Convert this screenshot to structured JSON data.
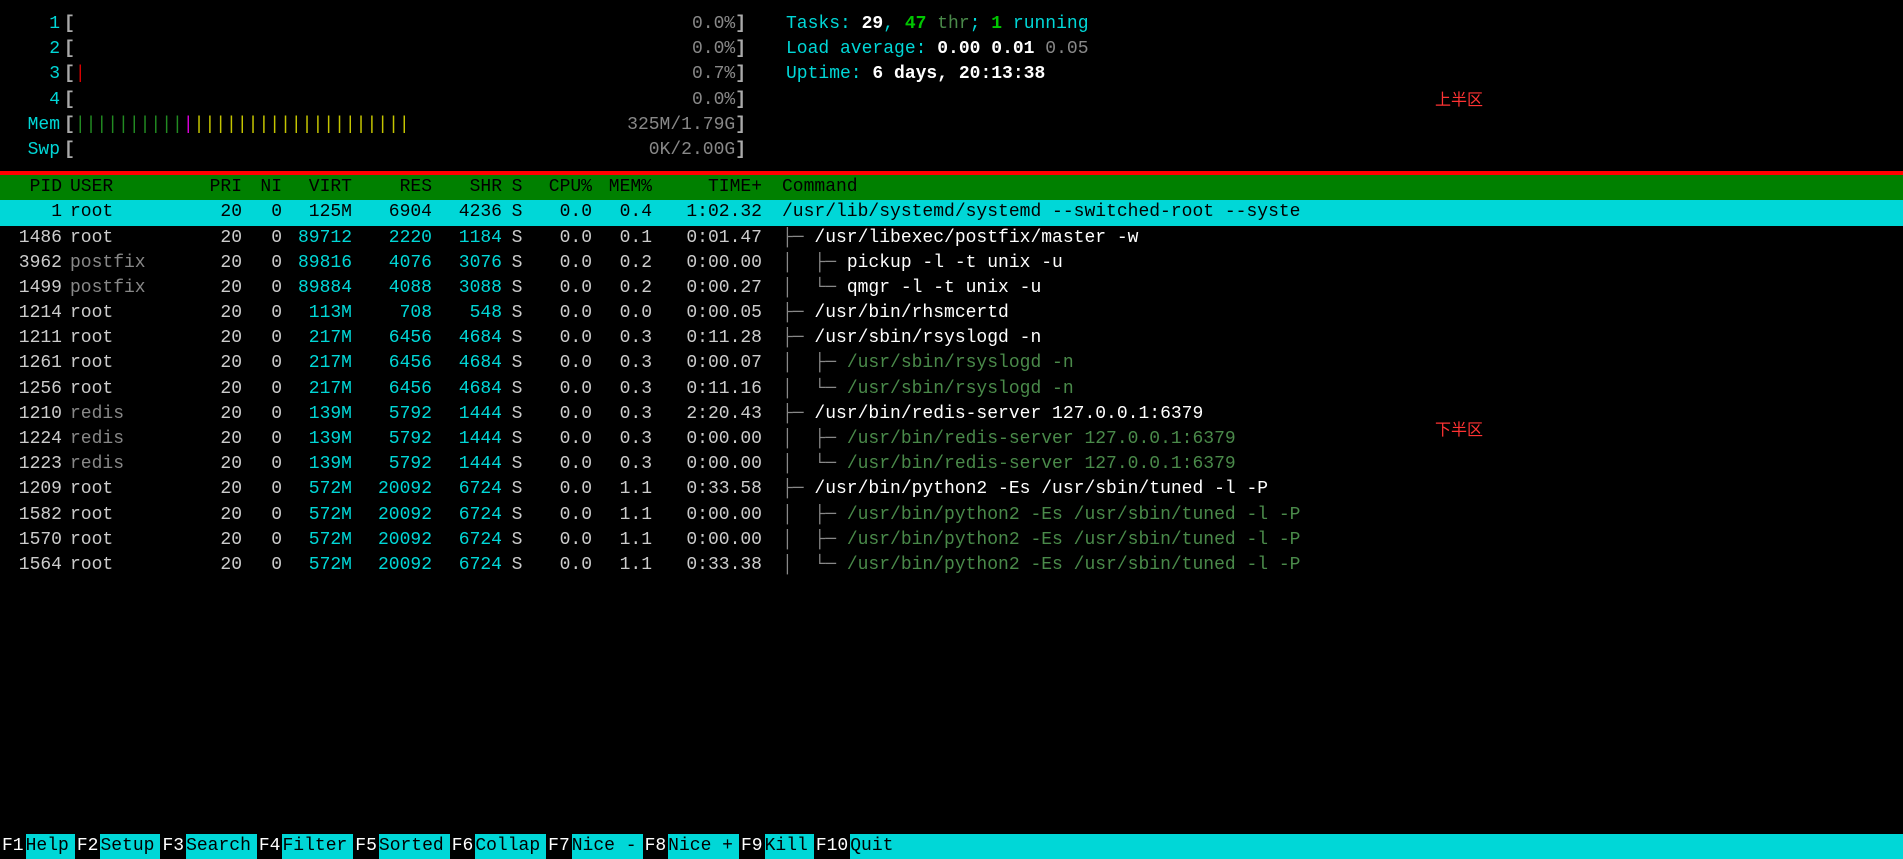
{
  "cpu_meters": [
    {
      "label": "1",
      "bar": "",
      "value": "0.0%"
    },
    {
      "label": "2",
      "bar": "",
      "value": "0.0%"
    },
    {
      "label": "3",
      "bar": "|",
      "value": "0.7%"
    },
    {
      "label": "4",
      "bar": "",
      "value": "0.0%"
    }
  ],
  "mem_meter": {
    "label": "Mem",
    "value": "325M/1.79G"
  },
  "swp_meter": {
    "label": "Swp",
    "value": "0K/2.00G"
  },
  "tasks": {
    "label": "Tasks: ",
    "total": "29",
    "sep": ", ",
    "threads": "47",
    "thr_label": " thr",
    "sep2": "; ",
    "running": "1",
    "running_label": " running"
  },
  "load": {
    "label": "Load average: ",
    "v1": "0.00",
    "v2": "0.01",
    "v3": "0.05"
  },
  "uptime": {
    "label": "Uptime: ",
    "value": "6 days, 20:13:38"
  },
  "region_labels": {
    "top": "上半区",
    "bottom": "下半区"
  },
  "columns": {
    "pid": "PID",
    "user": "USER",
    "pri": "PRI",
    "ni": "NI",
    "virt": "VIRT",
    "res": "RES",
    "shr": "SHR",
    "s": "S",
    "cpu": "CPU%",
    "mem": "MEM%",
    "time": "TIME+",
    "cmd": "Command"
  },
  "processes": [
    {
      "pid": "1",
      "user": "root",
      "user_sys": false,
      "pri": "20",
      "ni": "0",
      "virt": "125M",
      "res": "6904",
      "shr": "4236",
      "s": "S",
      "cpu": "0.0",
      "mem": "0.4",
      "time": "1:02.32",
      "tree": "",
      "cmd": "/usr/lib/systemd/systemd --switched-root --syste",
      "thread": false,
      "selected": true
    },
    {
      "pid": "1486",
      "user": "root",
      "user_sys": false,
      "pri": "20",
      "ni": "0",
      "virt": "89712",
      "res": "2220",
      "shr": "1184",
      "s": "S",
      "cpu": "0.0",
      "mem": "0.1",
      "time": "0:01.47",
      "tree": "├─ ",
      "cmd": "/usr/libexec/postfix/master -w",
      "thread": false
    },
    {
      "pid": "3962",
      "user": "postfix",
      "user_sys": true,
      "pri": "20",
      "ni": "0",
      "virt": "89816",
      "res": "4076",
      "shr": "3076",
      "s": "S",
      "cpu": "0.0",
      "mem": "0.2",
      "time": "0:00.00",
      "tree": "│  ├─ ",
      "cmd": "pickup -l -t unix -u",
      "thread": false
    },
    {
      "pid": "1499",
      "user": "postfix",
      "user_sys": true,
      "pri": "20",
      "ni": "0",
      "virt": "89884",
      "res": "4088",
      "shr": "3088",
      "s": "S",
      "cpu": "0.0",
      "mem": "0.2",
      "time": "0:00.27",
      "tree": "│  └─ ",
      "cmd": "qmgr -l -t unix -u",
      "thread": false
    },
    {
      "pid": "1214",
      "user": "root",
      "user_sys": false,
      "pri": "20",
      "ni": "0",
      "virt": "113M",
      "res": "708",
      "shr": "548",
      "s": "S",
      "cpu": "0.0",
      "mem": "0.0",
      "time": "0:00.05",
      "tree": "├─ ",
      "cmd": "/usr/bin/rhsmcertd",
      "thread": false
    },
    {
      "pid": "1211",
      "user": "root",
      "user_sys": false,
      "pri": "20",
      "ni": "0",
      "virt": "217M",
      "res": "6456",
      "shr": "4684",
      "s": "S",
      "cpu": "0.0",
      "mem": "0.3",
      "time": "0:11.28",
      "tree": "├─ ",
      "cmd": "/usr/sbin/rsyslogd -n",
      "thread": false
    },
    {
      "pid": "1261",
      "user": "root",
      "user_sys": false,
      "pri": "20",
      "ni": "0",
      "virt": "217M",
      "res": "6456",
      "shr": "4684",
      "s": "S",
      "cpu": "0.0",
      "mem": "0.3",
      "time": "0:00.07",
      "tree": "│  ├─ ",
      "cmd": "/usr/sbin/rsyslogd -n",
      "thread": true
    },
    {
      "pid": "1256",
      "user": "root",
      "user_sys": false,
      "pri": "20",
      "ni": "0",
      "virt": "217M",
      "res": "6456",
      "shr": "4684",
      "s": "S",
      "cpu": "0.0",
      "mem": "0.3",
      "time": "0:11.16",
      "tree": "│  └─ ",
      "cmd": "/usr/sbin/rsyslogd -n",
      "thread": true
    },
    {
      "pid": "1210",
      "user": "redis",
      "user_sys": true,
      "pri": "20",
      "ni": "0",
      "virt": "139M",
      "res": "5792",
      "shr": "1444",
      "s": "S",
      "cpu": "0.0",
      "mem": "0.3",
      "time": "2:20.43",
      "tree": "├─ ",
      "cmd": "/usr/bin/redis-server 127.0.0.1:6379",
      "thread": false
    },
    {
      "pid": "1224",
      "user": "redis",
      "user_sys": true,
      "pri": "20",
      "ni": "0",
      "virt": "139M",
      "res": "5792",
      "shr": "1444",
      "s": "S",
      "cpu": "0.0",
      "mem": "0.3",
      "time": "0:00.00",
      "tree": "│  ├─ ",
      "cmd": "/usr/bin/redis-server 127.0.0.1:6379",
      "thread": true
    },
    {
      "pid": "1223",
      "user": "redis",
      "user_sys": true,
      "pri": "20",
      "ni": "0",
      "virt": "139M",
      "res": "5792",
      "shr": "1444",
      "s": "S",
      "cpu": "0.0",
      "mem": "0.3",
      "time": "0:00.00",
      "tree": "│  └─ ",
      "cmd": "/usr/bin/redis-server 127.0.0.1:6379",
      "thread": true
    },
    {
      "pid": "1209",
      "user": "root",
      "user_sys": false,
      "pri": "20",
      "ni": "0",
      "virt": "572M",
      "res": "20092",
      "shr": "6724",
      "s": "S",
      "cpu": "0.0",
      "mem": "1.1",
      "time": "0:33.58",
      "tree": "├─ ",
      "cmd": "/usr/bin/python2 -Es /usr/sbin/tuned -l -P",
      "thread": false
    },
    {
      "pid": "1582",
      "user": "root",
      "user_sys": false,
      "pri": "20",
      "ni": "0",
      "virt": "572M",
      "res": "20092",
      "shr": "6724",
      "s": "S",
      "cpu": "0.0",
      "mem": "1.1",
      "time": "0:00.00",
      "tree": "│  ├─ ",
      "cmd": "/usr/bin/python2 -Es /usr/sbin/tuned -l -P",
      "thread": true
    },
    {
      "pid": "1570",
      "user": "root",
      "user_sys": false,
      "pri": "20",
      "ni": "0",
      "virt": "572M",
      "res": "20092",
      "shr": "6724",
      "s": "S",
      "cpu": "0.0",
      "mem": "1.1",
      "time": "0:00.00",
      "tree": "│  ├─ ",
      "cmd": "/usr/bin/python2 -Es /usr/sbin/tuned -l -P",
      "thread": true
    },
    {
      "pid": "1564",
      "user": "root",
      "user_sys": false,
      "pri": "20",
      "ni": "0",
      "virt": "572M",
      "res": "20092",
      "shr": "6724",
      "s": "S",
      "cpu": "0.0",
      "mem": "1.1",
      "time": "0:33.38",
      "tree": "│  └─ ",
      "cmd": "/usr/bin/python2 -Es /usr/sbin/tuned -l -P",
      "thread": true
    }
  ],
  "footer": [
    {
      "key": "F1",
      "label": "Help  "
    },
    {
      "key": "F2",
      "label": "Setup "
    },
    {
      "key": "F3",
      "label": "Search"
    },
    {
      "key": "F4",
      "label": "Filter"
    },
    {
      "key": "F5",
      "label": "Sorted"
    },
    {
      "key": "F6",
      "label": "Collap"
    },
    {
      "key": "F7",
      "label": "Nice -"
    },
    {
      "key": "F8",
      "label": "Nice +"
    },
    {
      "key": "F9",
      "label": "Kill  "
    },
    {
      "key": "F10",
      "label": "Quit  "
    }
  ]
}
